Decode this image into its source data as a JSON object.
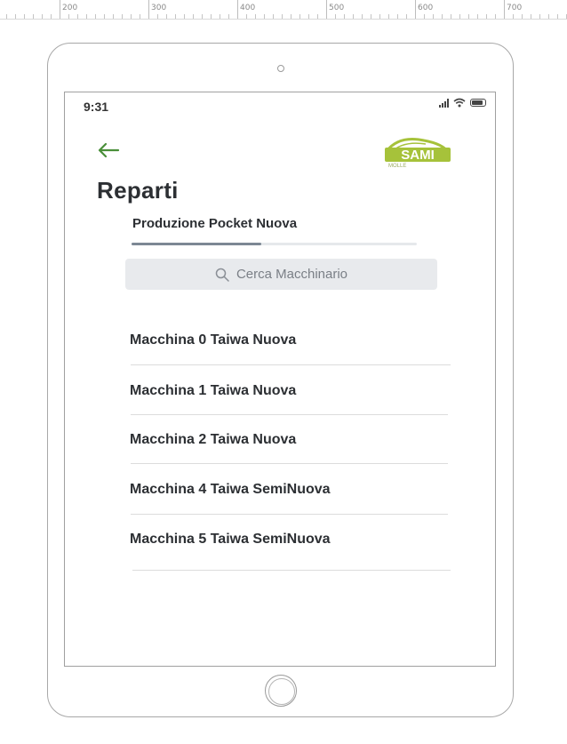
{
  "ruler": {
    "labels": [
      "200",
      "300",
      "400",
      "500",
      "600",
      "700"
    ]
  },
  "status_bar": {
    "time": "9:31",
    "icons": [
      "cellular-signal-icon",
      "wifi-icon",
      "battery-icon"
    ]
  },
  "header": {
    "back_icon": "arrow-left-icon",
    "logo_text": "SAMI",
    "logo_subtext": "MOLLE",
    "title": "Reparti"
  },
  "tabs": [
    {
      "label": "Produzione Pocket Nuova",
      "active": true
    }
  ],
  "search": {
    "icon": "search-icon",
    "placeholder": "Cerca Macchinario"
  },
  "machines": [
    "Macchina 0 Taiwa Nuova",
    "Macchina 1 Taiwa Nuova",
    "Macchina 2 Taiwa Nuova",
    "Macchina 4 Taiwa SemiNuova",
    "Macchina 5 Taiwa SemiNuova"
  ],
  "colors": {
    "accent_green": "#4a8f3a",
    "logo_lime": "#a6c23a",
    "text_dark": "#2c2f33",
    "search_bg": "#e8eaed"
  }
}
